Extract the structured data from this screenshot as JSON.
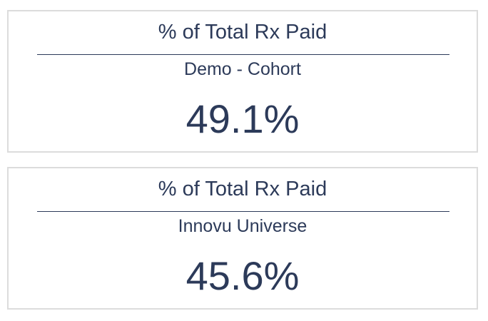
{
  "cards": [
    {
      "title": "% of Total Rx Paid",
      "subtitle": "Demo - Cohort",
      "value": "49.1%"
    },
    {
      "title": "% of Total Rx Paid",
      "subtitle": "Innovu Universe",
      "value": "45.6%"
    }
  ],
  "colors": {
    "text": "#2c3a59",
    "card_border": "#dcdcdc",
    "background": "#ffffff"
  }
}
